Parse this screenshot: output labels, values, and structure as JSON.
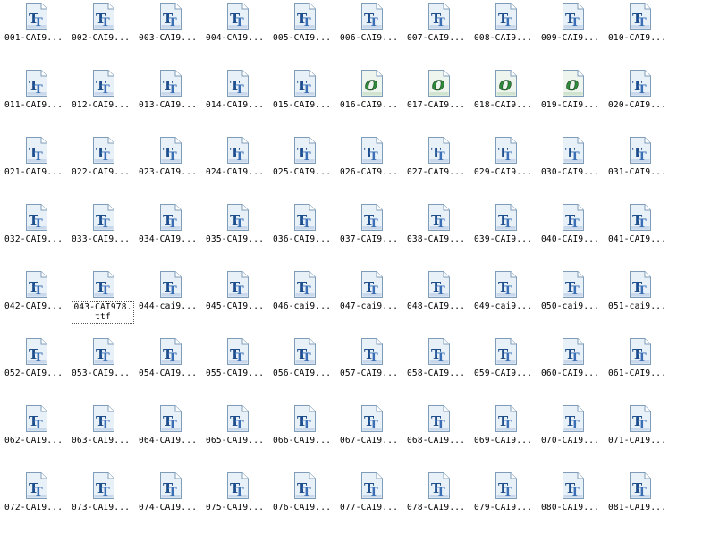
{
  "colors": {
    "tt_icon": "#1f4e8c",
    "otf_icon": "#2e8b3a",
    "page_fill": "#e8f0f8",
    "selection_border": "#555555"
  },
  "files": [
    {
      "label": "001-CAI9...",
      "icon": "truetype-font-icon"
    },
    {
      "label": "002-CAI9...",
      "icon": "truetype-font-icon"
    },
    {
      "label": "003-CAI9...",
      "icon": "truetype-font-icon"
    },
    {
      "label": "004-CAI9...",
      "icon": "truetype-font-icon"
    },
    {
      "label": "005-CAI9...",
      "icon": "truetype-font-icon"
    },
    {
      "label": "006-CAI9...",
      "icon": "truetype-font-icon"
    },
    {
      "label": "007-CAI9...",
      "icon": "truetype-font-icon"
    },
    {
      "label": "008-CAI9...",
      "icon": "truetype-font-icon"
    },
    {
      "label": "009-CAI9...",
      "icon": "truetype-font-icon"
    },
    {
      "label": "010-CAI9...",
      "icon": "truetype-font-icon"
    },
    {
      "label": "011-CAI9...",
      "icon": "truetype-font-icon"
    },
    {
      "label": "012-CAI9...",
      "icon": "truetype-font-icon"
    },
    {
      "label": "013-CAI9...",
      "icon": "truetype-font-icon"
    },
    {
      "label": "014-CAI9...",
      "icon": "truetype-font-icon"
    },
    {
      "label": "015-CAI9...",
      "icon": "truetype-font-icon"
    },
    {
      "label": "016-CAI9...",
      "icon": "opentype-font-icon"
    },
    {
      "label": "017-CAI9...",
      "icon": "opentype-font-icon"
    },
    {
      "label": "018-CAI9...",
      "icon": "opentype-font-icon"
    },
    {
      "label": "019-CAI9...",
      "icon": "opentype-font-icon"
    },
    {
      "label": "020-CAI9...",
      "icon": "truetype-font-icon"
    },
    {
      "label": "021-CAI9...",
      "icon": "truetype-font-icon"
    },
    {
      "label": "022-CAI9...",
      "icon": "truetype-font-icon"
    },
    {
      "label": "023-CAI9...",
      "icon": "truetype-font-icon"
    },
    {
      "label": "024-CAI9...",
      "icon": "truetype-font-icon"
    },
    {
      "label": "025-CAI9...",
      "icon": "truetype-font-icon"
    },
    {
      "label": "026-CAI9...",
      "icon": "truetype-font-icon"
    },
    {
      "label": "027-CAI9...",
      "icon": "truetype-font-icon"
    },
    {
      "label": "029-CAI9...",
      "icon": "truetype-font-icon"
    },
    {
      "label": "030-CAI9...",
      "icon": "truetype-font-icon"
    },
    {
      "label": "031-CAI9...",
      "icon": "truetype-font-icon"
    },
    {
      "label": "032-CAI9...",
      "icon": "truetype-font-icon"
    },
    {
      "label": "033-CAI9...",
      "icon": "truetype-font-icon"
    },
    {
      "label": "034-CAI9...",
      "icon": "truetype-font-icon"
    },
    {
      "label": "035-CAI9...",
      "icon": "truetype-font-icon"
    },
    {
      "label": "036-CAI9...",
      "icon": "truetype-font-icon"
    },
    {
      "label": "037-CAI9...",
      "icon": "truetype-font-icon"
    },
    {
      "label": "038-CAI9...",
      "icon": "truetype-font-icon"
    },
    {
      "label": "039-CAI9...",
      "icon": "truetype-font-icon"
    },
    {
      "label": "040-CAI9...",
      "icon": "truetype-font-icon"
    },
    {
      "label": "041-CAI9...",
      "icon": "truetype-font-icon"
    },
    {
      "label": "042-CAI9...",
      "icon": "truetype-font-icon"
    },
    {
      "label": "043-CAI978.ttf",
      "icon": "truetype-font-icon",
      "selected": true
    },
    {
      "label": "044-cai9...",
      "icon": "truetype-font-icon"
    },
    {
      "label": "045-CAI9...",
      "icon": "truetype-font-icon"
    },
    {
      "label": "046-cai9...",
      "icon": "truetype-font-icon"
    },
    {
      "label": "047-cai9...",
      "icon": "truetype-font-icon"
    },
    {
      "label": "048-CAI9...",
      "icon": "truetype-font-icon"
    },
    {
      "label": "049-cai9...",
      "icon": "truetype-font-icon"
    },
    {
      "label": "050-cai9...",
      "icon": "truetype-font-icon"
    },
    {
      "label": "051-cai9...",
      "icon": "truetype-font-icon"
    },
    {
      "label": "052-CAI9...",
      "icon": "truetype-font-icon"
    },
    {
      "label": "053-CAI9...",
      "icon": "truetype-font-icon"
    },
    {
      "label": "054-CAI9...",
      "icon": "truetype-font-icon"
    },
    {
      "label": "055-CAI9...",
      "icon": "truetype-font-icon"
    },
    {
      "label": "056-CAI9...",
      "icon": "truetype-font-icon"
    },
    {
      "label": "057-CAI9...",
      "icon": "truetype-font-icon"
    },
    {
      "label": "058-CAI9...",
      "icon": "truetype-font-icon"
    },
    {
      "label": "059-CAI9...",
      "icon": "truetype-font-icon"
    },
    {
      "label": "060-CAI9...",
      "icon": "truetype-font-icon"
    },
    {
      "label": "061-CAI9...",
      "icon": "truetype-font-icon"
    },
    {
      "label": "062-CAI9...",
      "icon": "truetype-font-icon"
    },
    {
      "label": "063-CAI9...",
      "icon": "truetype-font-icon"
    },
    {
      "label": "064-CAI9...",
      "icon": "truetype-font-icon"
    },
    {
      "label": "065-CAI9...",
      "icon": "truetype-font-icon"
    },
    {
      "label": "066-CAI9...",
      "icon": "truetype-font-icon"
    },
    {
      "label": "067-CAI9...",
      "icon": "truetype-font-icon"
    },
    {
      "label": "068-CAI9...",
      "icon": "truetype-font-icon"
    },
    {
      "label": "069-CAI9...",
      "icon": "truetype-font-icon"
    },
    {
      "label": "070-CAI9...",
      "icon": "truetype-font-icon"
    },
    {
      "label": "071-CAI9...",
      "icon": "truetype-font-icon"
    },
    {
      "label": "072-CAI9...",
      "icon": "truetype-font-icon"
    },
    {
      "label": "073-CAI9...",
      "icon": "truetype-font-icon"
    },
    {
      "label": "074-CAI9...",
      "icon": "truetype-font-icon"
    },
    {
      "label": "075-CAI9...",
      "icon": "truetype-font-icon"
    },
    {
      "label": "076-CAI9...",
      "icon": "truetype-font-icon"
    },
    {
      "label": "077-CAI9...",
      "icon": "truetype-font-icon"
    },
    {
      "label": "078-CAI9...",
      "icon": "truetype-font-icon"
    },
    {
      "label": "079-CAI9...",
      "icon": "truetype-font-icon"
    },
    {
      "label": "080-CAI9...",
      "icon": "truetype-font-icon"
    },
    {
      "label": "081-CAI9...",
      "icon": "truetype-font-icon"
    }
  ]
}
